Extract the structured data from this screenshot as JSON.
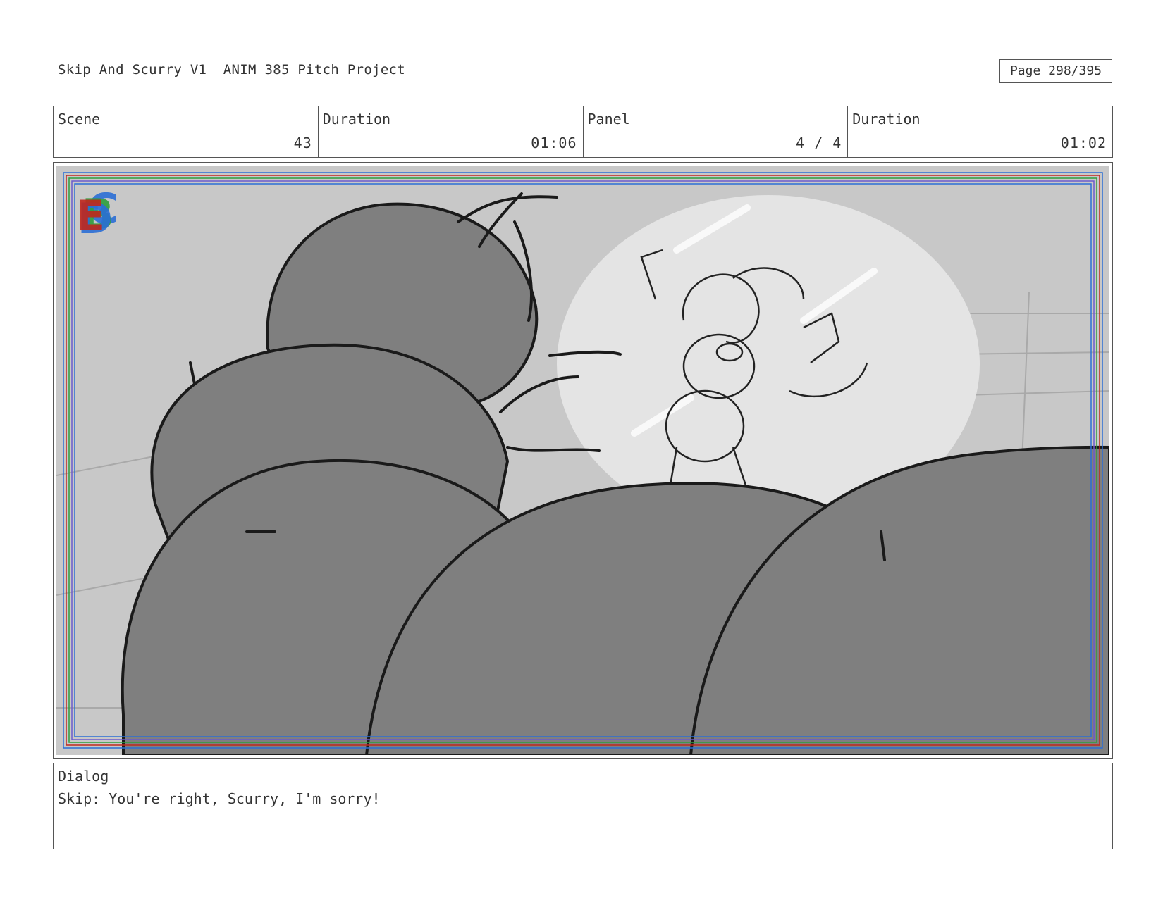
{
  "header": {
    "title": "Skip And Scurry V1  ANIM 385 Pitch Project",
    "page": "Page 298/395"
  },
  "info": {
    "scene_label": "Scene",
    "scene_value": "43",
    "scene_duration_label": "Duration",
    "scene_duration_value": "01:06",
    "panel_label": "Panel",
    "panel_value": "4 / 4",
    "panel_duration_label": "Duration",
    "panel_duration_value": "01:02"
  },
  "artwork": {
    "description_icon": "storyboard-sketch",
    "guide_colors": [
      "#2b6fd6",
      "#2e9e3c",
      "#c0271d",
      "#6a5acd"
    ],
    "fill_colors": {
      "background": "#c8c8c8",
      "body": "#7f7f7f",
      "bubble": "#e6e6e6",
      "line": "#1a1a1a"
    }
  },
  "dialog": {
    "label": "Dialog",
    "text": "Skip: You're right, Scurry, I'm sorry!"
  }
}
